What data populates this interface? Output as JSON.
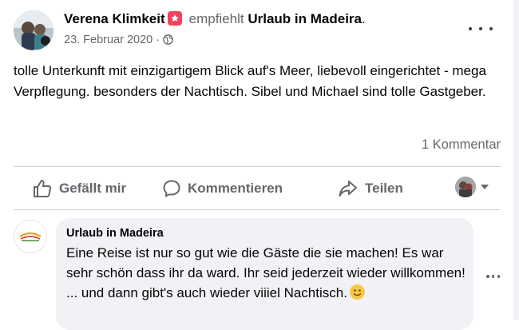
{
  "post": {
    "author": "Verena Klimkeit",
    "verb": "empfiehlt",
    "page": "Urlaub in Madeira",
    "period": ".",
    "date": "23. Februar 2020",
    "date_sep": "·",
    "privacy_icon": "globe-icon",
    "text": "tolle Unterkunft mit einzigartigem Blick auf's Meer, liebevoll eingerichtet - mega Verpflegung. besonders der Nachtisch. Sibel und Michael sind tolle Gastgeber.",
    "comment_count": "1 Kommentar"
  },
  "actions": {
    "like": "Gefällt mir",
    "comment": "Kommentieren",
    "share": "Teilen"
  },
  "comment": {
    "author": "Urlaub in Madeira",
    "text": "Eine Reise ist nur so gut wie die Gäste die sie machen! Es war sehr schön dass ihr da ward. Ihr seid jederzeit wieder willkommen! ... und dann gibt's auch wieder viiiel Nachtisch.",
    "emoji": "smile-emoji"
  },
  "colors": {
    "recommend_badge": "#f3425f",
    "secondary_text": "#65676b",
    "bubble_bg": "#f0f2f5"
  }
}
